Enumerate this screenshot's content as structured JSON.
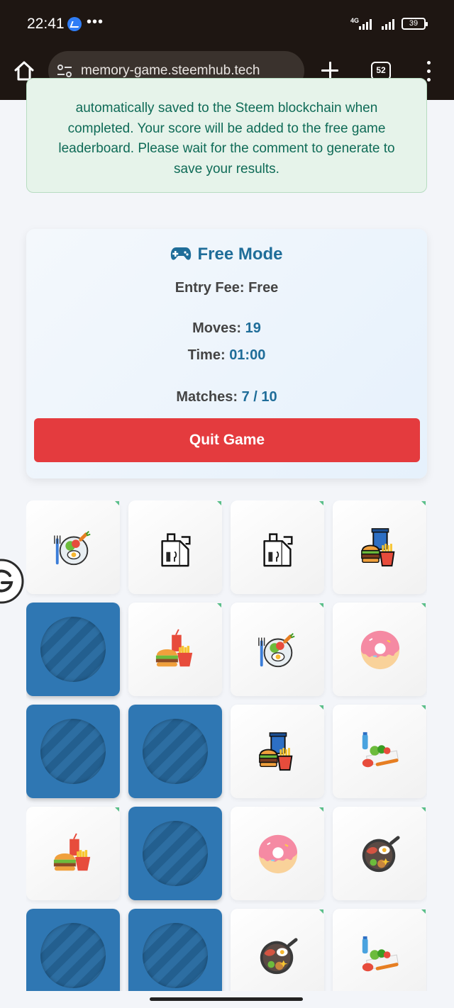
{
  "status_bar": {
    "time": "22:41",
    "network": "4G",
    "battery": "39"
  },
  "browser": {
    "url": "memory-game.steemhub.tech",
    "tab_count": "52"
  },
  "notice": {
    "text": "automatically saved to the Steem blockchain when completed. Your score will be added to the free game leaderboard. Please wait for the comment to generate to save your results."
  },
  "game": {
    "mode_title": "Free Mode",
    "entry_fee_label": "Entry Fee:",
    "entry_fee_value": "Free",
    "moves_label": "Moves:",
    "moves_value": "19",
    "time_label": "Time:",
    "time_value": "01:00",
    "matches_label": "Matches:",
    "matches_value": "7 / 10",
    "quit_label": "Quit Game"
  },
  "board": {
    "columns": 4,
    "cards": [
      {
        "state": "matched",
        "icon": "salad-plate-icon"
      },
      {
        "state": "matched",
        "icon": "takeaway-bag-icon"
      },
      {
        "state": "matched",
        "icon": "takeaway-bag-icon"
      },
      {
        "state": "matched",
        "icon": "burger-combo-icon"
      },
      {
        "state": "hidden",
        "icon": "card-back"
      },
      {
        "state": "matched",
        "icon": "fast-food-meal-icon"
      },
      {
        "state": "matched",
        "icon": "salad-plate-icon"
      },
      {
        "state": "matched",
        "icon": "donut-icon"
      },
      {
        "state": "hidden",
        "icon": "card-back"
      },
      {
        "state": "hidden",
        "icon": "card-back"
      },
      {
        "state": "matched",
        "icon": "burger-combo-icon"
      },
      {
        "state": "matched",
        "icon": "healthy-food-icon"
      },
      {
        "state": "matched",
        "icon": "fast-food-meal-icon"
      },
      {
        "state": "hidden",
        "icon": "card-back"
      },
      {
        "state": "matched",
        "icon": "donut-icon"
      },
      {
        "state": "matched",
        "icon": "breakfast-pan-icon"
      },
      {
        "state": "hidden",
        "icon": "card-back"
      },
      {
        "state": "hidden",
        "icon": "card-back"
      },
      {
        "state": "matched",
        "icon": "breakfast-pan-icon"
      },
      {
        "state": "matched",
        "icon": "healthy-food-icon"
      }
    ]
  },
  "colors": {
    "accent": "#1f6d99",
    "quit": "#e43b3e",
    "card_back": "#2f77b3",
    "notice_text": "#0f6b57"
  }
}
